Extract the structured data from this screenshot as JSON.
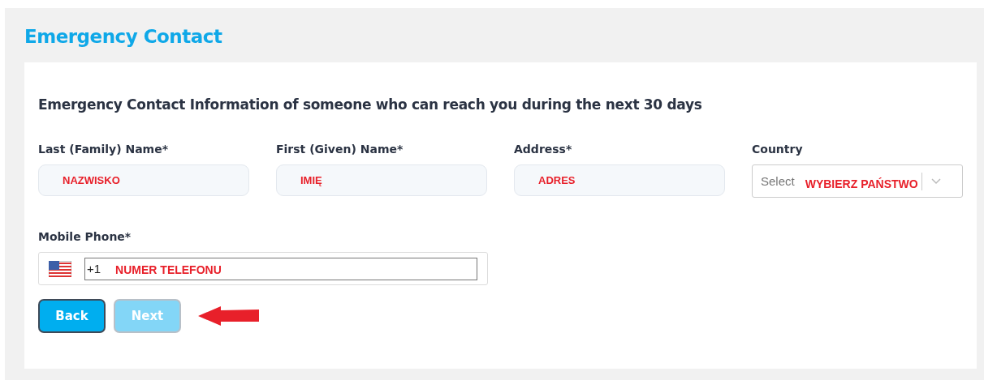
{
  "page_title": "Emergency Contact",
  "section_heading": "Emergency Contact Information of someone who can reach you during the next 30 days",
  "fields": [
    {
      "kind": "text",
      "label": "Last (Family) Name*",
      "annotation": "NAZWISKO"
    },
    {
      "kind": "text",
      "label": "First (Given) Name*",
      "annotation": "IMIĘ"
    },
    {
      "kind": "text",
      "label": "Address*",
      "annotation": "ADRES"
    },
    {
      "kind": "select",
      "label": "Country",
      "placeholder": "Select",
      "annotation": "WYBIERZ PAŃSTWO"
    }
  ],
  "phone": {
    "label": "Mobile Phone*",
    "value": "+1",
    "annotation": "NUMER TELEFONU"
  },
  "buttons": [
    {
      "label": "Back",
      "disabled": false
    },
    {
      "label": "Next",
      "disabled": true
    }
  ],
  "pointer_arrow": {
    "kind": "arrow"
  }
}
